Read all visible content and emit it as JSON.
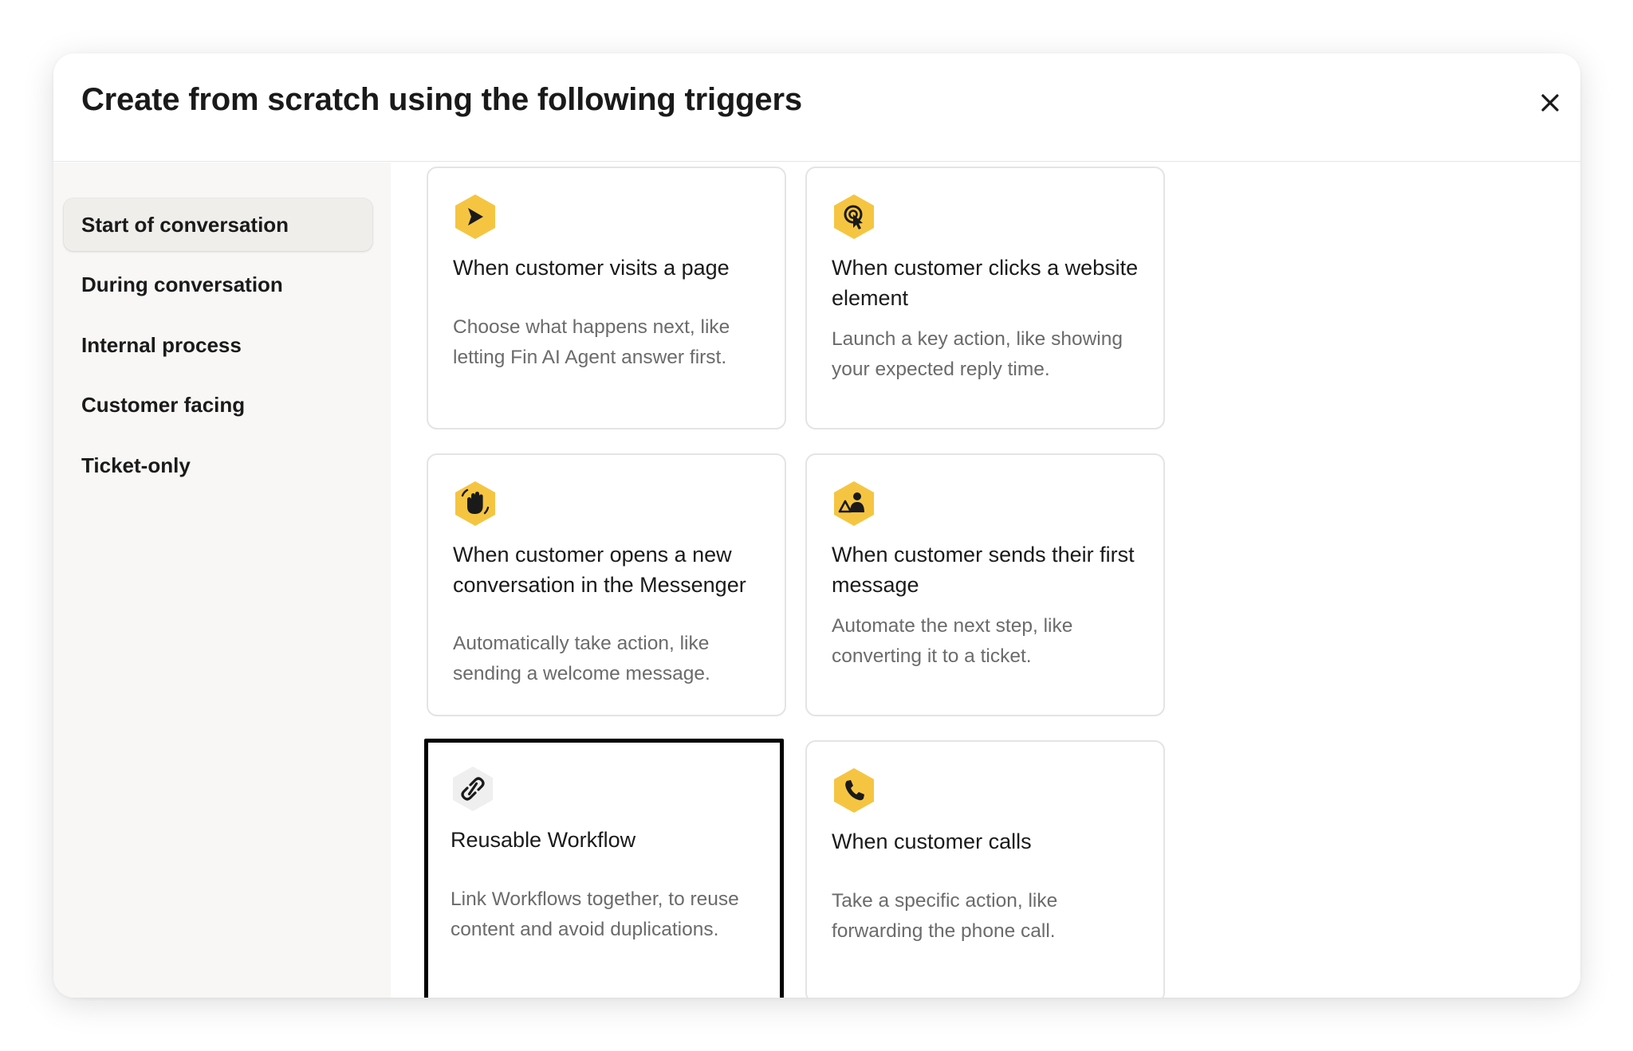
{
  "modal": {
    "title": "Create from scratch using the following triggers",
    "close_icon": "close-icon"
  },
  "sidebar": {
    "items": [
      {
        "label": "Start of conversation",
        "active": true
      },
      {
        "label": "During conversation",
        "active": false
      },
      {
        "label": "Internal process",
        "active": false
      },
      {
        "label": "Customer facing",
        "active": false
      },
      {
        "label": "Ticket-only",
        "active": false
      }
    ]
  },
  "triggers": [
    {
      "icon": "send-arrow-icon",
      "icon_color": "#f5c542",
      "title": "When customer visits a page",
      "description": "Choose what happens next, like letting Fin AI Agent answer first."
    },
    {
      "icon": "cursor-click-icon",
      "icon_color": "#f5c542",
      "title": "When customer clicks a website element",
      "description": "Launch a key action, like showing your expected reply time."
    },
    {
      "icon": "wave-hand-icon",
      "icon_color": "#f5c542",
      "title": "When customer opens a new conversation in the Messenger",
      "description": "Automatically take action, like sending a welcome message."
    },
    {
      "icon": "person-message-icon",
      "icon_color": "#f5c542",
      "title": "When customer sends their first message",
      "description": "Automate the next step, like converting it to a ticket."
    },
    {
      "icon": "link-icon",
      "icon_color": "#efefef",
      "title": "Reusable Workflow",
      "description": "Link Workflows together, to reuse content and avoid duplications.",
      "selected": true
    },
    {
      "icon": "phone-icon",
      "icon_color": "#f5c542",
      "title": "When customer calls",
      "description": "Take a specific action, like forwarding the phone call."
    }
  ]
}
